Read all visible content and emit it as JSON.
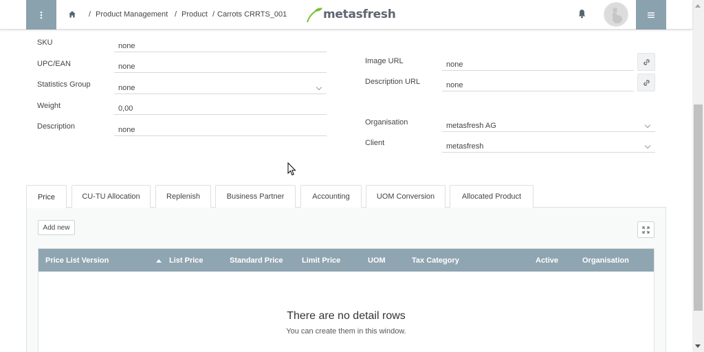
{
  "header": {
    "breadcrumb": [
      "/",
      "Product Management",
      "/",
      "Product",
      "/",
      "Carrots CRRTS_001"
    ],
    "logo_text": "metasfresh",
    "accent_color": "#8aa1ae",
    "logo_green": "#7cbf2e"
  },
  "form_left": [
    {
      "label": "SKU",
      "value": "none",
      "dropdown": false
    },
    {
      "label": "UPC/EAN",
      "value": "none",
      "dropdown": false
    },
    {
      "label": "Statistics Group",
      "value": "none",
      "dropdown": true
    },
    {
      "label": "Weight",
      "value": "0,00",
      "dropdown": false
    },
    {
      "label": "Description",
      "value": "none",
      "dropdown": false
    }
  ],
  "form_right": [
    {
      "label": "Image URL",
      "value": "none",
      "icon": "link-icon"
    },
    {
      "label": "Description URL",
      "value": "none",
      "icon": "link-icon"
    },
    {
      "label": "Organisation",
      "value": "metasfresh AG",
      "dropdown": true
    },
    {
      "label": "Client",
      "value": "metasfresh",
      "dropdown": true
    }
  ],
  "tabs": [
    "Price",
    "CU-TU Allocation",
    "Replenish",
    "Business Partner",
    "Accounting",
    "UOM Conversion",
    "Allocated Product"
  ],
  "active_tab": "Price",
  "actions": {
    "add_new": "Add new"
  },
  "grid": {
    "columns": [
      "Price List Version",
      "List Price",
      "Standard Price",
      "Limit Price",
      "UOM",
      "Tax Category",
      "Active",
      "Organisation"
    ],
    "sorted_column": "Price List Version",
    "empty_title": "There are no detail rows",
    "empty_sub": "You can create them in this window."
  }
}
